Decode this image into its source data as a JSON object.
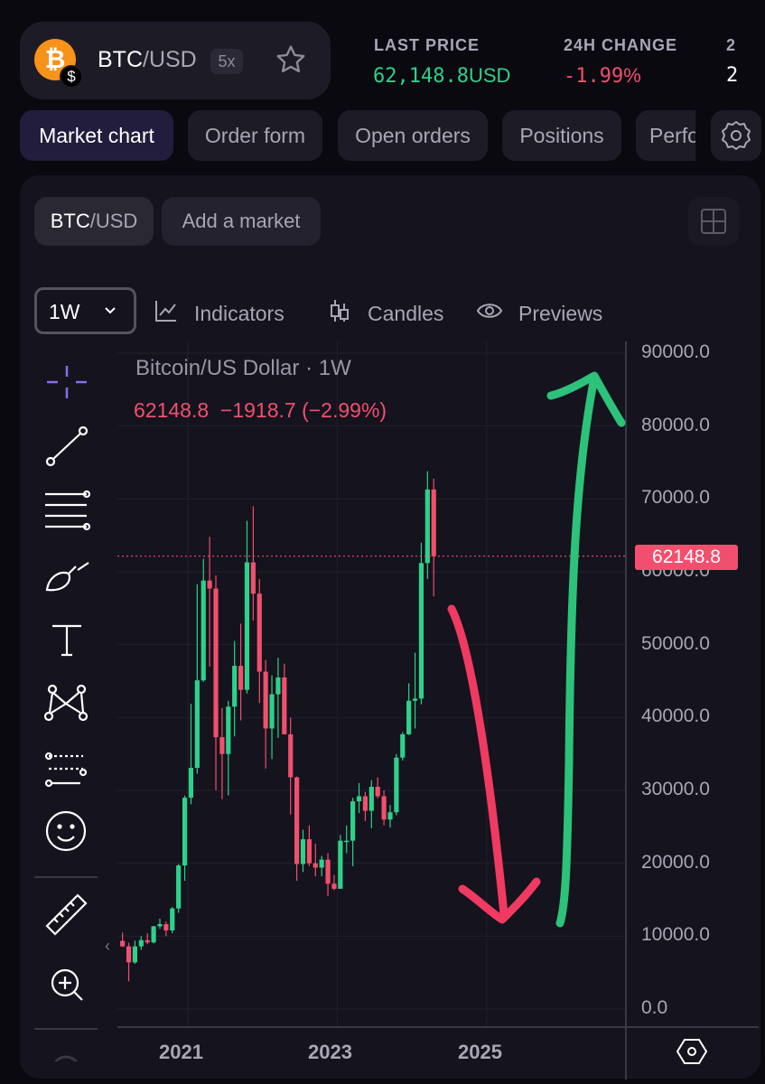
{
  "header": {
    "pair_base": "BTC",
    "pair_quote": "/USD",
    "leverage": "5x",
    "coin_icon": "bitcoin-icon",
    "last_price_label": "LAST PRICE",
    "last_price_value": "62,148.8",
    "last_price_unit": "USD",
    "change_label": "24H CHANGE",
    "change_value": "-1.99",
    "change_unit": "%",
    "extra_label": "2",
    "extra_value": "2",
    "colors": {
      "up": "#2fd08a",
      "down": "#f0506e",
      "accent": "#f7931a"
    }
  },
  "tabs": [
    {
      "label": "Market chart",
      "active": true
    },
    {
      "label": "Order form"
    },
    {
      "label": "Open orders"
    },
    {
      "label": "Positions"
    },
    {
      "label": "Perfo"
    }
  ],
  "market_tabs": {
    "active_base": "BTC",
    "active_quote": "/USD",
    "add_label": "Add a market"
  },
  "toolbar": {
    "interval": "1W",
    "indicators": "Indicators",
    "candles": "Candles",
    "previews": "Previews"
  },
  "legend": {
    "title": "Bitcoin/US Dollar · 1W",
    "last": "62148.8",
    "change": "−1918.7",
    "change_pct": "(−2.99%)"
  },
  "price_label": "62148.8",
  "left_tools": [
    "crosshair-icon",
    "trend-line-icon",
    "fib-lines-icon",
    "brush-icon",
    "text-icon",
    "pattern-icon",
    "forecast-icon",
    "emoji-icon",
    "ruler-icon",
    "zoom-in-icon"
  ],
  "chart_data": {
    "type": "candlestick",
    "title": "Bitcoin/US Dollar · 1W",
    "ylim": [
      0,
      90000
    ],
    "y_ticks": [
      "90000.0",
      "80000.0",
      "70000.0",
      "60000.0",
      "50000.0",
      "40000.0",
      "30000.0",
      "20000.0",
      "10000.0",
      "0.0"
    ],
    "x_ticks": [
      "2021",
      "2023",
      "2025"
    ],
    "current_price": 62148.8,
    "first_open": 9350,
    "dates": [
      "2020-02",
      "2020-03",
      "2020-04",
      "2020-05",
      "2020-06",
      "2020-07",
      "2020-08",
      "2020-09",
      "2020-10",
      "2020-11",
      "2020-12",
      "2021-01",
      "2021-02",
      "2021-03",
      "2021-04",
      "2021-05",
      "2021-06",
      "2021-07",
      "2021-08",
      "2021-09",
      "2021-10",
      "2021-11",
      "2021-12",
      "2022-01",
      "2022-02",
      "2022-03",
      "2022-04",
      "2022-05",
      "2022-06",
      "2022-07",
      "2022-08",
      "2022-09",
      "2022-10",
      "2022-11",
      "2022-12",
      "2023-01",
      "2023-02",
      "2023-03",
      "2023-04",
      "2023-05",
      "2023-06",
      "2023-07",
      "2023-08",
      "2023-09",
      "2023-10",
      "2023-11",
      "2023-12",
      "2024-01",
      "2024-02",
      "2024-03",
      "2024-04"
    ],
    "close": [
      8600,
      6400,
      8600,
      9450,
      9140,
      11350,
      11650,
      10780,
      13800,
      19700,
      29000,
      33100,
      45100,
      58800,
      57700,
      37300,
      35000,
      41500,
      47100,
      43800,
      61300,
      57000,
      46300,
      38500,
      43200,
      45500,
      37700,
      31800,
      19900,
      23300,
      20000,
      19400,
      20500,
      17200,
      16500,
      23100,
      23100,
      28500,
      29200,
      27200,
      30500,
      29200,
      26000,
      27000,
      34500,
      37700,
      42300,
      42600,
      61200,
      71300,
      62148.8
    ],
    "high": [
      10500,
      9100,
      9400,
      10000,
      10400,
      11400,
      12400,
      12000,
      14000,
      19900,
      29300,
      41900,
      58300,
      61800,
      64800,
      59500,
      41300,
      42300,
      50500,
      52900,
      67000,
      69000,
      59000,
      47900,
      45800,
      48200,
      47400,
      40000,
      31900,
      24600,
      25200,
      22700,
      21000,
      21400,
      18400,
      23900,
      25200,
      29000,
      31000,
      29800,
      31400,
      31800,
      30000,
      28000,
      35000,
      38000,
      44700,
      48900,
      64000,
      73800,
      72800
    ],
    "low": [
      8500,
      3800,
      6200,
      8100,
      8900,
      9000,
      11000,
      10000,
      10400,
      13200,
      17600,
      28100,
      32300,
      44900,
      47000,
      30000,
      28800,
      29300,
      37400,
      39600,
      43300,
      53300,
      42000,
      33000,
      34300,
      37200,
      37700,
      26700,
      17600,
      18800,
      19600,
      18200,
      18200,
      15500,
      16300,
      16500,
      21400,
      19600,
      26900,
      25800,
      24800,
      28900,
      25200,
      24900,
      26600,
      34100,
      37600,
      38500,
      41800,
      59000,
      56600
    ]
  }
}
